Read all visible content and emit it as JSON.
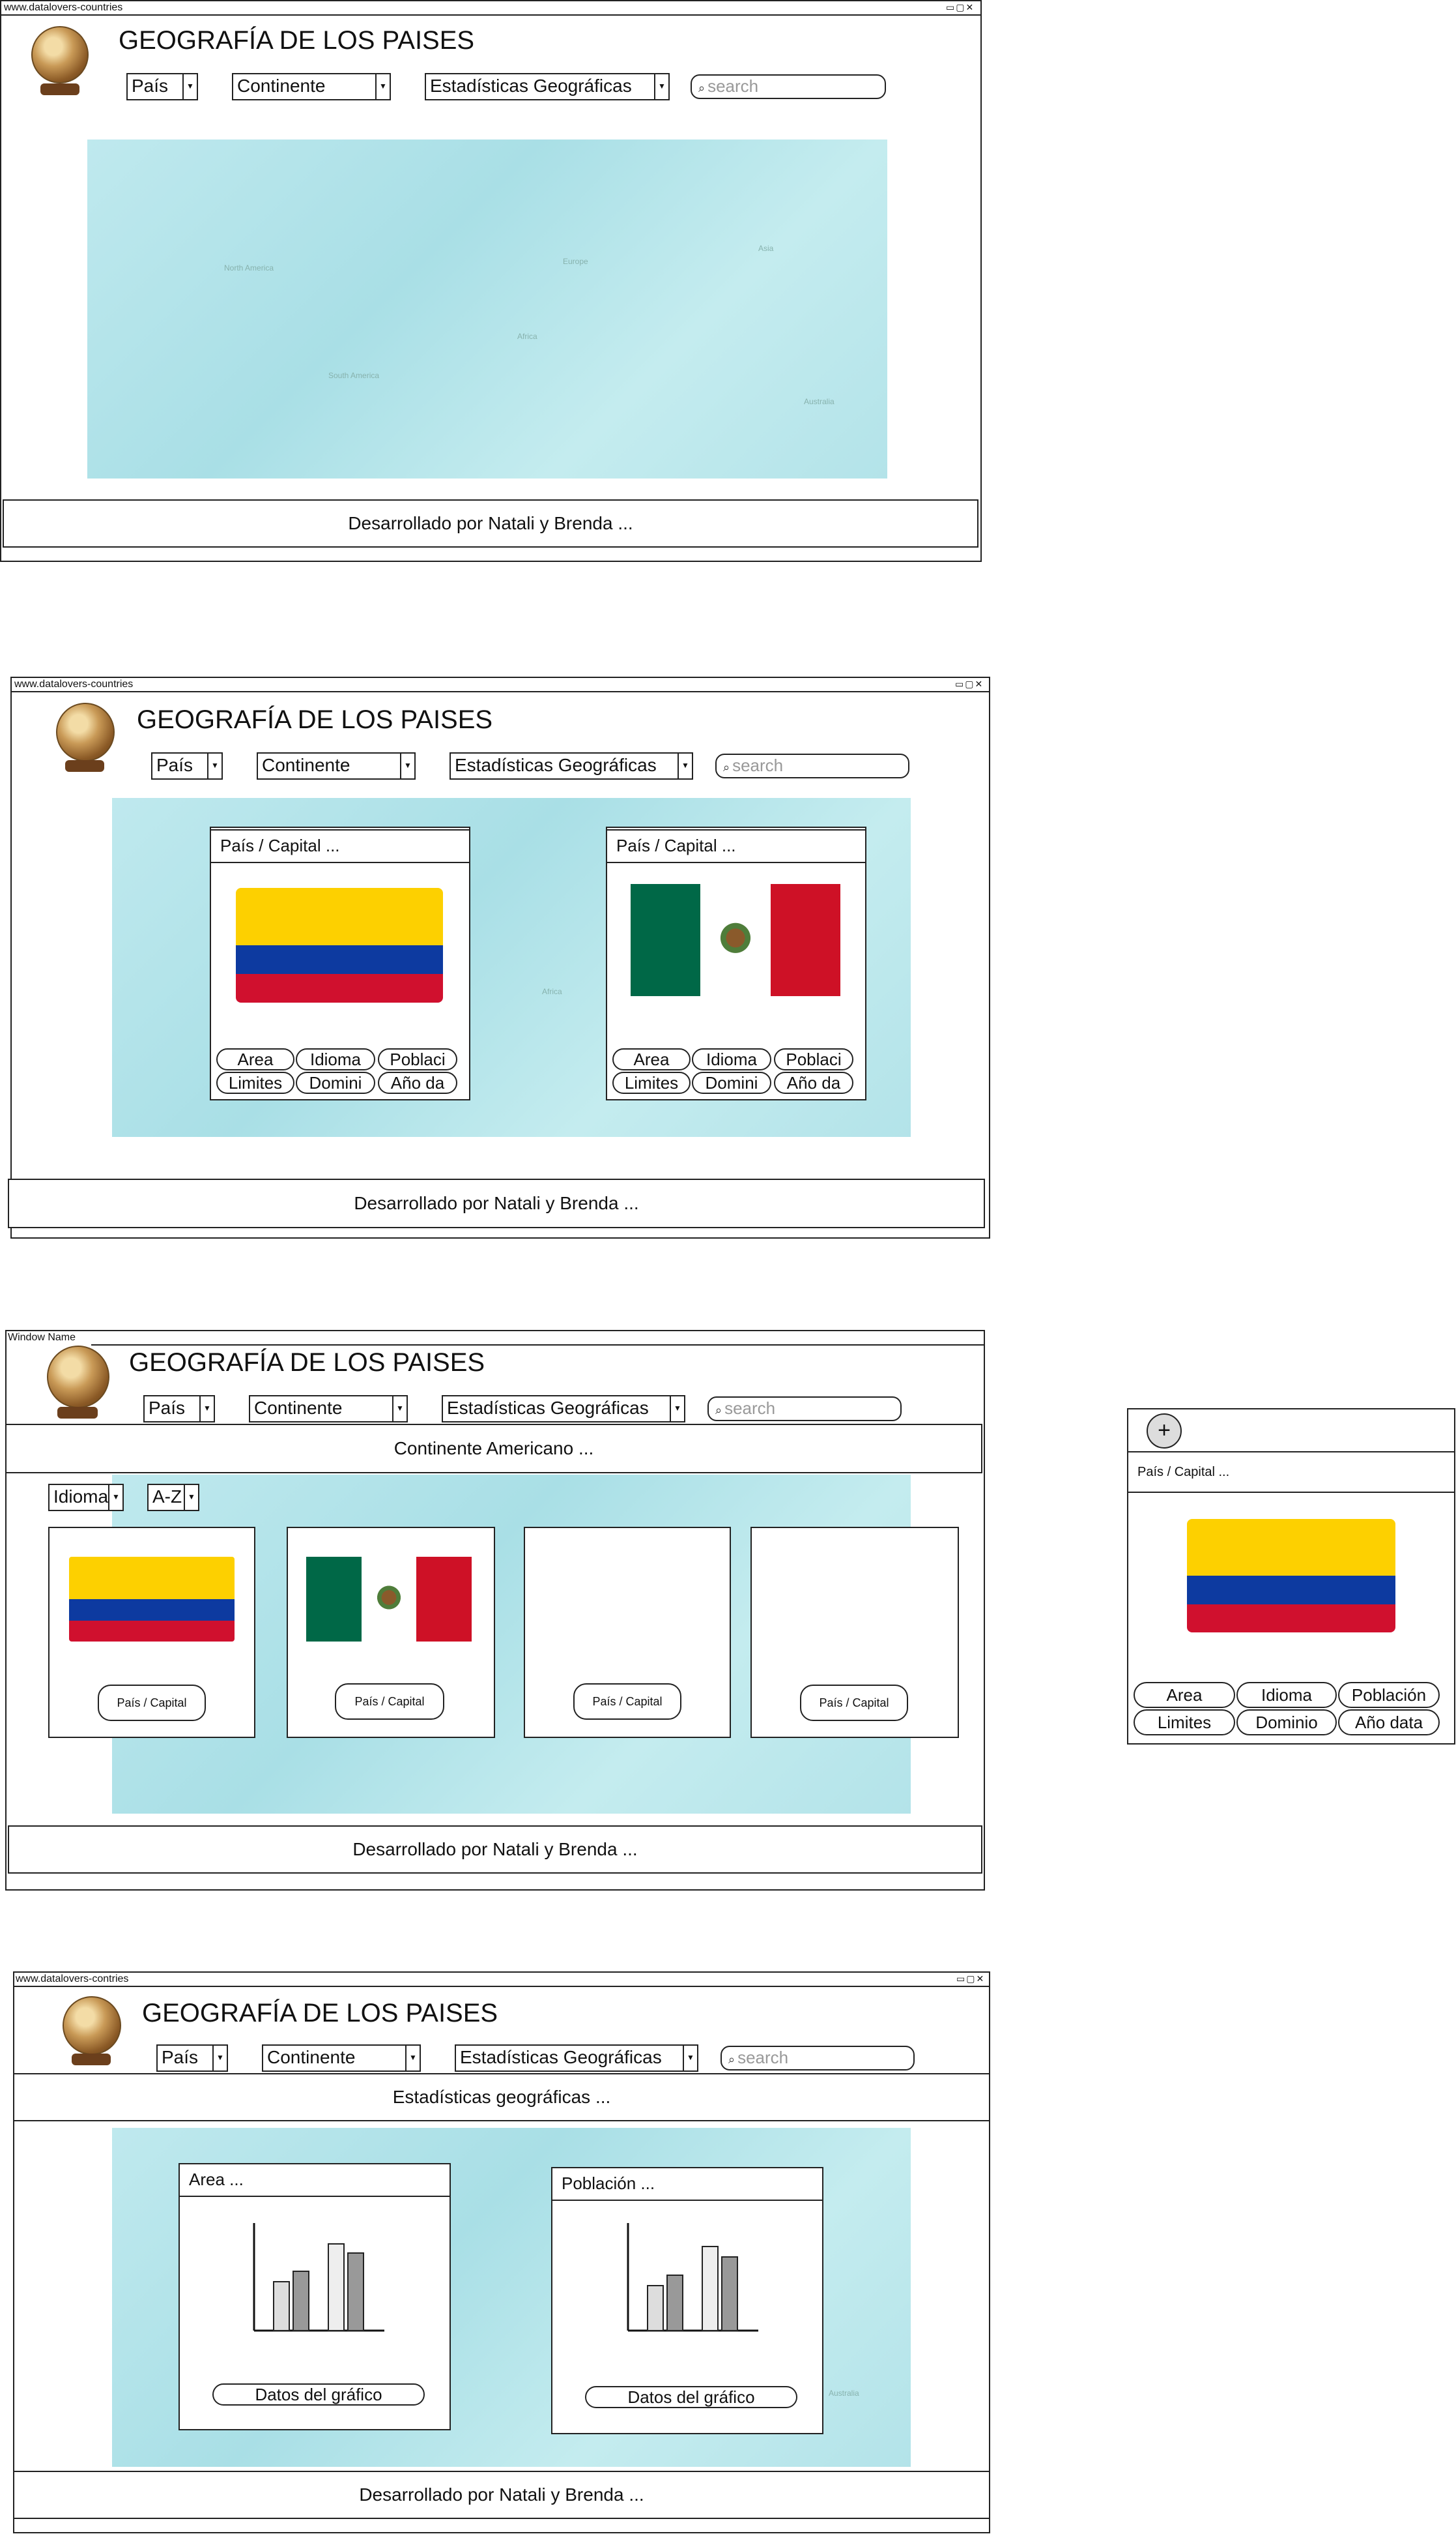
{
  "common": {
    "title": "GEOGRAFÍA DE LOS PAISES",
    "dd_country": "País",
    "dd_continent": "Continente",
    "dd_stats": "Estadísticas Geográficas",
    "search_placeholder": "search",
    "footer": "Desarrollado por Natali y Brenda  ...",
    "window_controls": "▭▢✕"
  },
  "mock1": {
    "url": "www.datalovers-countries",
    "map_labels": [
      "North America",
      "Europe",
      "Asia",
      "Africa",
      "South America",
      "Australia"
    ]
  },
  "mock2": {
    "url": "www.datalovers-countries",
    "cards": [
      {
        "title": "País / Capital  ...",
        "flag": "colombia",
        "pills": [
          "Area",
          "Idioma",
          "Poblaci",
          "Limites",
          "Domini",
          "Año da"
        ]
      },
      {
        "title": "País / Capital  ...",
        "flag": "mexico",
        "pills": [
          "Area",
          "Idioma",
          "Poblaci",
          "Limites",
          "Domini",
          "Año da"
        ]
      }
    ],
    "map_label_africa": "Africa"
  },
  "mock3": {
    "url": "Window Name",
    "section": "Continente Americano  ...",
    "filter_language": "Idioma",
    "filter_sort": "A-Z",
    "cards": [
      {
        "flag": "colombia",
        "label": "País / Capital"
      },
      {
        "flag": "mexico",
        "label": "País / Capital"
      },
      {
        "flag": "none",
        "label": "País / Capital"
      },
      {
        "flag": "none",
        "label": "País / Capital"
      }
    ]
  },
  "side_card": {
    "add_icon": "+",
    "title": "País / Capital  ...",
    "flag": "colombia",
    "pills": [
      "Area",
      "Idioma",
      "Población",
      "Limites",
      "Dominio",
      "Año data"
    ]
  },
  "mock4": {
    "url": "www.datalovers-contries",
    "section": "Estadísticas geográficas  ...",
    "panels": [
      {
        "title": "Area  ...",
        "button": "Datos del gráfico"
      },
      {
        "title": "Población  ...",
        "button": "Datos del gráfico"
      }
    ],
    "map_label_australia": "Australia"
  }
}
